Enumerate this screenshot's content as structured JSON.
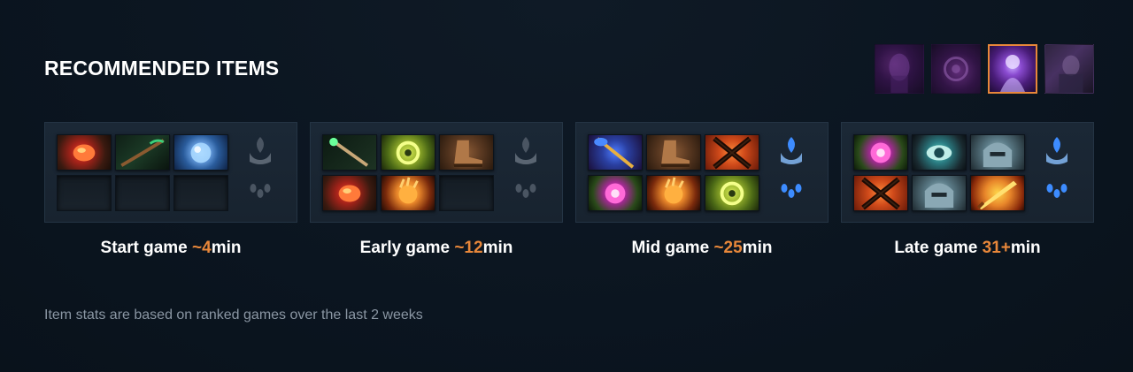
{
  "header": {
    "title": "RECOMMENDED ITEMS"
  },
  "hero_tabs": [
    {
      "icon": "hero-portrait-1",
      "selected": false
    },
    {
      "icon": "hero-portrait-2",
      "selected": false
    },
    {
      "icon": "hero-portrait-3",
      "selected": true
    },
    {
      "icon": "hero-portrait-4",
      "selected": false
    }
  ],
  "stages": [
    {
      "label": "Start game ",
      "time": "~4",
      "unit": "min",
      "items": [
        "mango",
        "branch",
        "orb",
        "empty",
        "empty",
        "empty"
      ],
      "neutral_active": false
    },
    {
      "label": "Early game ",
      "time": "~12",
      "unit": "min",
      "items": [
        "wand",
        "ring",
        "boots",
        "mango",
        "gauntlet",
        "empty"
      ],
      "neutral_active": false
    },
    {
      "label": "Mid game ",
      "time": "~25",
      "unit": "min",
      "items": [
        "staff",
        "boots",
        "swords",
        "orchid",
        "gauntlet",
        "ring"
      ],
      "neutral_active": true
    },
    {
      "label": "Late game ",
      "time": "31+",
      "unit": "min",
      "items": [
        "orchid",
        "eye",
        "helm",
        "swords",
        "helm",
        "blade"
      ],
      "neutral_active": true
    }
  ],
  "footnote": "Item stats are based on ranked games over the last 2 weeks",
  "colors": {
    "accent": "#e8873a",
    "background": "#0b1520",
    "panel": "#1b2836",
    "footnote": "#8a96a3",
    "neutral_active": "#3d8cff",
    "neutral_inactive": "#4a5562"
  }
}
